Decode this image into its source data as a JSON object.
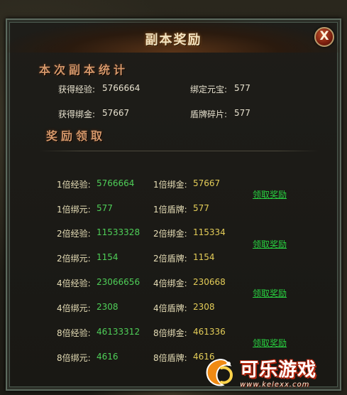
{
  "window": {
    "title": "副本奖励",
    "close_label": "X"
  },
  "stats_section": {
    "title": "本次副本统计",
    "items": [
      {
        "label": "获得经验:",
        "value": "5766664"
      },
      {
        "label": "绑定元宝:",
        "value": "577"
      },
      {
        "label": "获得绑金:",
        "value": "57667"
      },
      {
        "label": "盾牌碎片:",
        "value": "577"
      }
    ]
  },
  "rewards_section": {
    "title": "奖励领取",
    "claim_label": "领取奖励",
    "tiers": [
      {
        "exp_label": "1倍经验:",
        "exp_value": "5766664",
        "gold_label": "1倍绑金:",
        "gold_value": "57667",
        "yuan_label": "1倍绑元:",
        "yuan_value": "577",
        "shield_label": "1倍盾牌:",
        "shield_value": "577"
      },
      {
        "exp_label": "2倍经验:",
        "exp_value": "11533328",
        "gold_label": "2倍绑金:",
        "gold_value": "115334",
        "yuan_label": "2倍绑元:",
        "yuan_value": "1154",
        "shield_label": "2倍盾牌:",
        "shield_value": "1154"
      },
      {
        "exp_label": "4倍经验:",
        "exp_value": "23066656",
        "gold_label": "4倍绑金:",
        "gold_value": "230668",
        "yuan_label": "4倍绑元:",
        "yuan_value": "2308",
        "shield_label": "4倍盾牌:",
        "shield_value": "2308"
      },
      {
        "exp_label": "8倍经验:",
        "exp_value": "46133312",
        "gold_label": "8倍绑金:",
        "gold_value": "461336",
        "yuan_label": "8倍绑元:",
        "yuan_value": "4616",
        "shield_label": "8倍盾牌:",
        "shield_value": "4616"
      }
    ]
  },
  "watermark": {
    "name": "可乐游戏",
    "url": "www.kelexx.com",
    "icon": "kele-logo-icon"
  },
  "colors": {
    "title_text": "#f3e3c0",
    "section_title": "#d4976a",
    "green_value": "#4fcf58",
    "yellow_value": "#e4cd58",
    "claim_link": "#28d240",
    "close_button": "#a8361a"
  }
}
